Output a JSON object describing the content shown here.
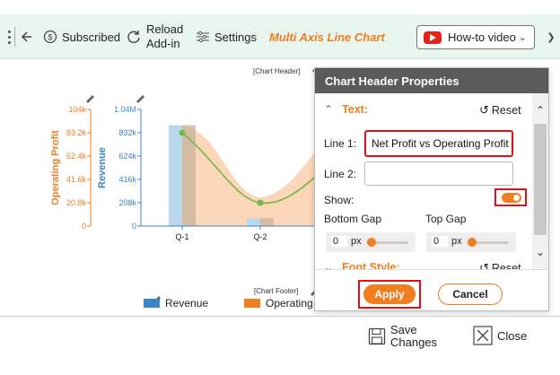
{
  "toolbar": {
    "subscribed_label": "Subscribed",
    "reload_label": "Reload\nAdd-in",
    "settings_label": "Settings",
    "app_title": "Multi Axis Line Chart",
    "howto_label": "How-to video"
  },
  "chart": {
    "header_tag": "[Chart Header]",
    "footer_tag": "[Chart Footer]"
  },
  "chart_data": {
    "type": "bar",
    "categories": [
      "Q-1",
      "Q-2"
    ],
    "series": [
      {
        "name": "Revenue",
        "type": "bar",
        "axis": "left-inner",
        "values": [
          900000,
          70000
        ],
        "color": "#b9d7ea"
      },
      {
        "name": "Operating Profit",
        "type": "area",
        "axis": "left-outer",
        "values": [
          83200,
          20800
        ],
        "color": "#fbd2b0"
      },
      {
        "name": "Net Profit",
        "type": "line",
        "values": [
          83200,
          20800
        ],
        "color": "#72b84a"
      }
    ],
    "axes": [
      {
        "label": "Operating Profit",
        "ticks": [
          "0",
          "20.8k",
          "41.6k",
          "62.4k",
          "83.2k",
          "104k"
        ],
        "range": [
          0,
          104000
        ],
        "color": "#f07d1e"
      },
      {
        "label": "Revenue",
        "ticks": [
          "0",
          "208k",
          "416k",
          "624k",
          "832k",
          "1.04M"
        ],
        "range": [
          0,
          1040000
        ],
        "color": "#3b86c4"
      }
    ],
    "legend": [
      "Revenue",
      "Operating"
    ],
    "legend_position": "bottom",
    "grid": false
  },
  "panel": {
    "title": "Chart Header Properties",
    "text_section": "Text:",
    "reset_label": "Reset",
    "line1_label": "Line 1:",
    "line1_value": "Net Profit vs Operating Profit",
    "line2_label": "Line 2:",
    "line2_value": "",
    "show_label": "Show:",
    "show_on": true,
    "bottom_gap_label": "Bottom Gap",
    "bottom_gap_value": "0",
    "top_gap_label": "Top Gap",
    "top_gap_value": "0",
    "unit": "px",
    "font_section": "Font Style:",
    "apply_label": "Apply",
    "cancel_label": "Cancel"
  },
  "bottom": {
    "save_label": "Save\nChanges",
    "close_label": "Close"
  },
  "icons": {
    "subscribed": "dollar-circle-icon",
    "reload": "refresh-icon",
    "settings": "sliders-icon",
    "youtube": "youtube-icon",
    "save": "save-icon",
    "close": "close-box-icon",
    "edit": "pencil-icon"
  },
  "colors": {
    "accent": "#f07d1e",
    "revenue_axis": "#3b86c4",
    "line": "#72b84a",
    "highlight": "#e0101b",
    "toolbar_bg": "#e8f5ed",
    "panel_header": "#5a5a5a"
  }
}
